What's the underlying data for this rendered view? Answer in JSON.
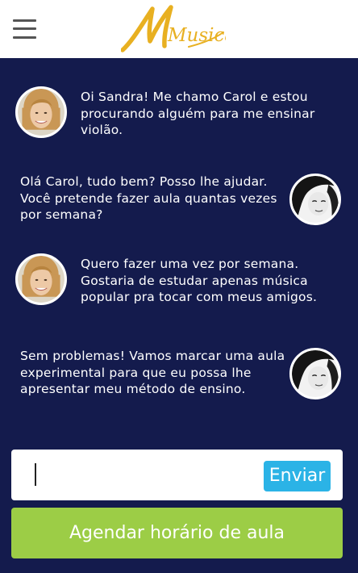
{
  "app": {
    "logo_text": "Musicar",
    "brand_color": "#e8b021",
    "menu_icon": "hamburger-menu-icon"
  },
  "chat": {
    "messages": [
      {
        "sender": "Carol",
        "side": "left",
        "text": "Oi Sandra! Me chamo Carol e estou procurando alguém para me ensinar violão."
      },
      {
        "sender": "Sandra",
        "side": "right",
        "text": "Olá Carol, tudo bem? Posso lhe ajudar. Você pretende fazer aula quantas vezes por semana?"
      },
      {
        "sender": "Carol",
        "side": "left",
        "text": "Quero fazer uma vez por semana. Gostaria de estudar apenas música popular pra tocar com meus amigos."
      },
      {
        "sender": "Sandra",
        "side": "right",
        "text": "Sem problemas! Vamos marcar uma aula experimental para que eu possa lhe apresentar meu método de ensino."
      }
    ]
  },
  "composer": {
    "value": "",
    "send_label": "Enviar"
  },
  "actions": {
    "schedule_label": "Agendar horário de aula"
  },
  "colors": {
    "background": "#141b4d",
    "send_button": "#2bb3e6",
    "schedule_button": "#9ccd46"
  }
}
